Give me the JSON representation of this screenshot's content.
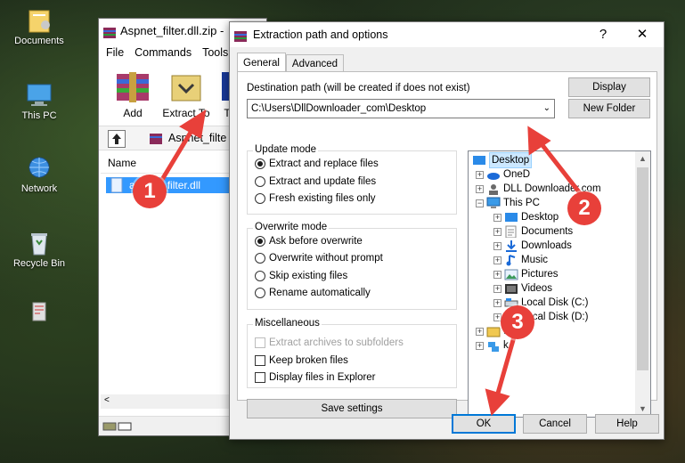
{
  "desktop": {
    "icons": [
      {
        "label": "Documents"
      },
      {
        "label": "This PC"
      },
      {
        "label": "Network"
      },
      {
        "label": "Recycle Bin"
      }
    ]
  },
  "winrar": {
    "title": "Aspnet_filter.dll.zip -",
    "menu": [
      "File",
      "Commands",
      "Tools"
    ],
    "toolbar": {
      "add": "Add",
      "extract_to": "Extract To",
      "third": "T"
    },
    "address": "Aspnet_filte",
    "list_header": "Name",
    "selected_file": "aspnet_filter.dll"
  },
  "dialog": {
    "title": "Extraction path and options",
    "help_glyph": "?",
    "close_glyph": "✕",
    "tabs": [
      "General",
      "Advanced"
    ],
    "dest_label": "Destination path (will be created if does not exist)",
    "dest_value": "C:\\Users\\DllDownloader_com\\Desktop",
    "display_button": "Display",
    "new_folder_button": "New Folder",
    "update_mode": {
      "title": "Update mode",
      "options": [
        "Extract and replace files",
        "Extract and update files",
        "Fresh existing files only"
      ],
      "selected": 0
    },
    "overwrite_mode": {
      "title": "Overwrite mode",
      "options": [
        "Ask before overwrite",
        "Overwrite without prompt",
        "Skip existing files",
        "Rename automatically"
      ],
      "selected": 0
    },
    "misc": {
      "title": "Miscellaneous",
      "options": [
        "Extract archives to subfolders",
        "Keep broken files",
        "Display files in Explorer"
      ]
    },
    "save_settings": "Save settings",
    "tree": {
      "items": [
        "Desktop",
        "OneD",
        "DLL Downloader.com",
        "This PC",
        "Desktop",
        "Documents",
        "Downloads",
        "Music",
        "Pictures",
        "Videos",
        "Local Disk (C:)",
        "Local Disk (D:)",
        "L",
        "k"
      ]
    },
    "ok_button": "OK",
    "cancel_button": "Cancel",
    "help_button": "Help"
  },
  "annotations": [
    "1",
    "2",
    "3"
  ],
  "colors": {
    "annotation": "#e8403a",
    "selection": "#3399ff",
    "accent": "#0078d7"
  }
}
